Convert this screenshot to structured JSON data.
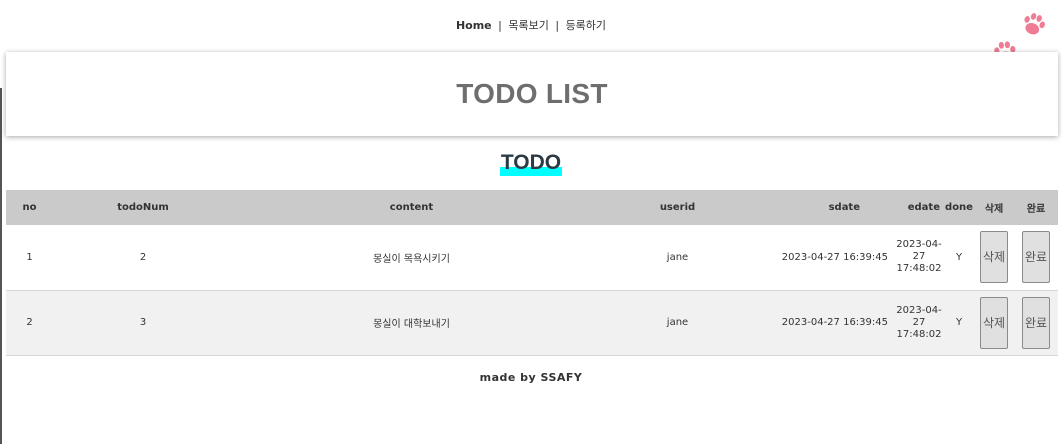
{
  "nav": {
    "home": "Home",
    "sep1": "|",
    "list": "목록보기",
    "sep2": "|",
    "register": "등록하기"
  },
  "banner": {
    "title": "TODO LIST"
  },
  "section": {
    "title": "TODO"
  },
  "table": {
    "headers": {
      "no": "no",
      "todoNum": "todoNum",
      "content": "content",
      "userid": "userid",
      "sdate": "sdate",
      "edate": "edate",
      "done": "done",
      "delete": "삭제",
      "complete": "완료"
    },
    "rows": [
      {
        "no": "1",
        "todoNum": "2",
        "content": "몽실이 목욕시키기",
        "userid": "jane",
        "sdate": "2023-04-27 16:39:45",
        "edate": "2023-04-27 17:48:02",
        "done": "Y",
        "delete_label": "삭제",
        "complete_label": "완료"
      },
      {
        "no": "2",
        "todoNum": "3",
        "content": "몽실이 대학보내기",
        "userid": "jane",
        "sdate": "2023-04-27 16:39:45",
        "edate": "2023-04-27 17:48:02",
        "done": "Y",
        "delete_label": "삭제",
        "complete_label": "완료"
      }
    ]
  },
  "footer": {
    "text": "made by SSAFY"
  },
  "colors": {
    "paw": "#ef7c93",
    "highlight": "#00ffff",
    "header_bg": "#cacaca"
  }
}
